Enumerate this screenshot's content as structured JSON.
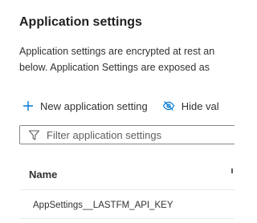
{
  "section": {
    "title": "Application settings",
    "description_line1": "Application settings are encrypted at rest an",
    "description_line2": "below. Application Settings are exposed as"
  },
  "toolbar": {
    "new_label": "New application setting",
    "new_icon": "plus-icon",
    "hide_label": "Hide val",
    "hide_icon": "eye-off-icon"
  },
  "filter": {
    "placeholder": "Filter application settings",
    "icon": "filter-icon"
  },
  "table": {
    "columns": [
      "Name"
    ],
    "rows": [
      {
        "name": "AppSettings__LASTFM_API_KEY"
      }
    ]
  },
  "colors": {
    "accent": "#0078d4",
    "text": "#323130",
    "border": "#8a8886",
    "divider": "#edebe9"
  }
}
